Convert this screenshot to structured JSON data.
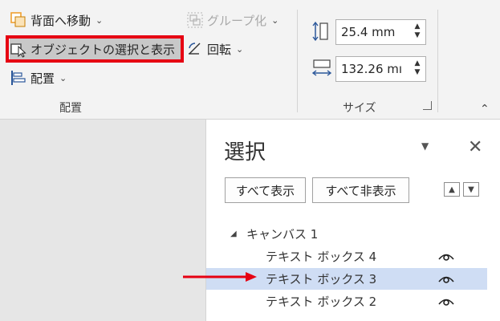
{
  "ribbon": {
    "arrange_group": {
      "label": "配置",
      "send_backward": "背面へ移動",
      "selection_pane": "オブジェクトの選択と表示",
      "align": "配置",
      "group": "グループ化",
      "rotate": "回転"
    },
    "size_group": {
      "label": "サイズ",
      "height_value": "25.4 mm",
      "width_value": "132.26 mı"
    }
  },
  "selection_pane": {
    "title": "選択",
    "show_all": "すべて表示",
    "hide_all": "すべて非表示",
    "tree": {
      "root": "キャンバス 1",
      "items": [
        {
          "label": "テキスト ボックス 4",
          "selected": false
        },
        {
          "label": "テキスト ボックス 3",
          "selected": true
        },
        {
          "label": "テキスト ボックス 2",
          "selected": false
        }
      ]
    }
  },
  "colors": {
    "highlight_border": "#e60012",
    "selected_row": "#cfddf4",
    "icon_blue": "#2b579a",
    "icon_orange": "#f0a030"
  }
}
